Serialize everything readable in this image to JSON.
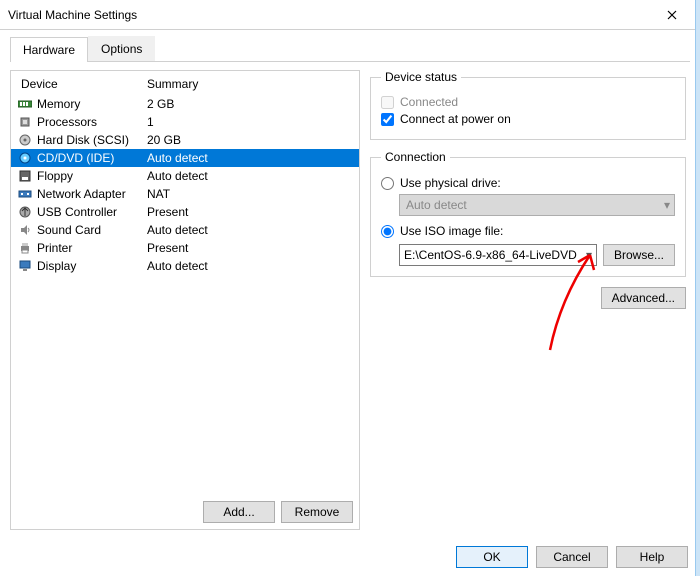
{
  "window": {
    "title": "Virtual Machine Settings"
  },
  "tabs": {
    "hardware": "Hardware",
    "options": "Options"
  },
  "headers": {
    "device": "Device",
    "summary": "Summary"
  },
  "devices": [
    {
      "name": "Memory",
      "summary": "2 GB",
      "icon": "memory-icon"
    },
    {
      "name": "Processors",
      "summary": "1",
      "icon": "cpu-icon"
    },
    {
      "name": "Hard Disk (SCSI)",
      "summary": "20 GB",
      "icon": "disk-icon"
    },
    {
      "name": "CD/DVD (IDE)",
      "summary": "Auto detect",
      "icon": "cd-icon"
    },
    {
      "name": "Floppy",
      "summary": "Auto detect",
      "icon": "floppy-icon"
    },
    {
      "name": "Network Adapter",
      "summary": "NAT",
      "icon": "net-icon"
    },
    {
      "name": "USB Controller",
      "summary": "Present",
      "icon": "usb-icon"
    },
    {
      "name": "Sound Card",
      "summary": "Auto detect",
      "icon": "sound-icon"
    },
    {
      "name": "Printer",
      "summary": "Present",
      "icon": "printer-icon"
    },
    {
      "name": "Display",
      "summary": "Auto detect",
      "icon": "display-icon"
    }
  ],
  "selected_index": 3,
  "left_buttons": {
    "add": "Add...",
    "remove": "Remove"
  },
  "status": {
    "legend": "Device status",
    "connected": "Connected",
    "power_on": "Connect at power on"
  },
  "connection": {
    "legend": "Connection",
    "physical": "Use physical drive:",
    "physical_value": "Auto detect",
    "iso": "Use ISO image file:",
    "iso_value": "E:\\CentOS-6.9-x86_64-LiveDVD",
    "browse": "Browse..."
  },
  "advanced": "Advanced...",
  "footer": {
    "ok": "OK",
    "cancel": "Cancel",
    "help": "Help"
  }
}
